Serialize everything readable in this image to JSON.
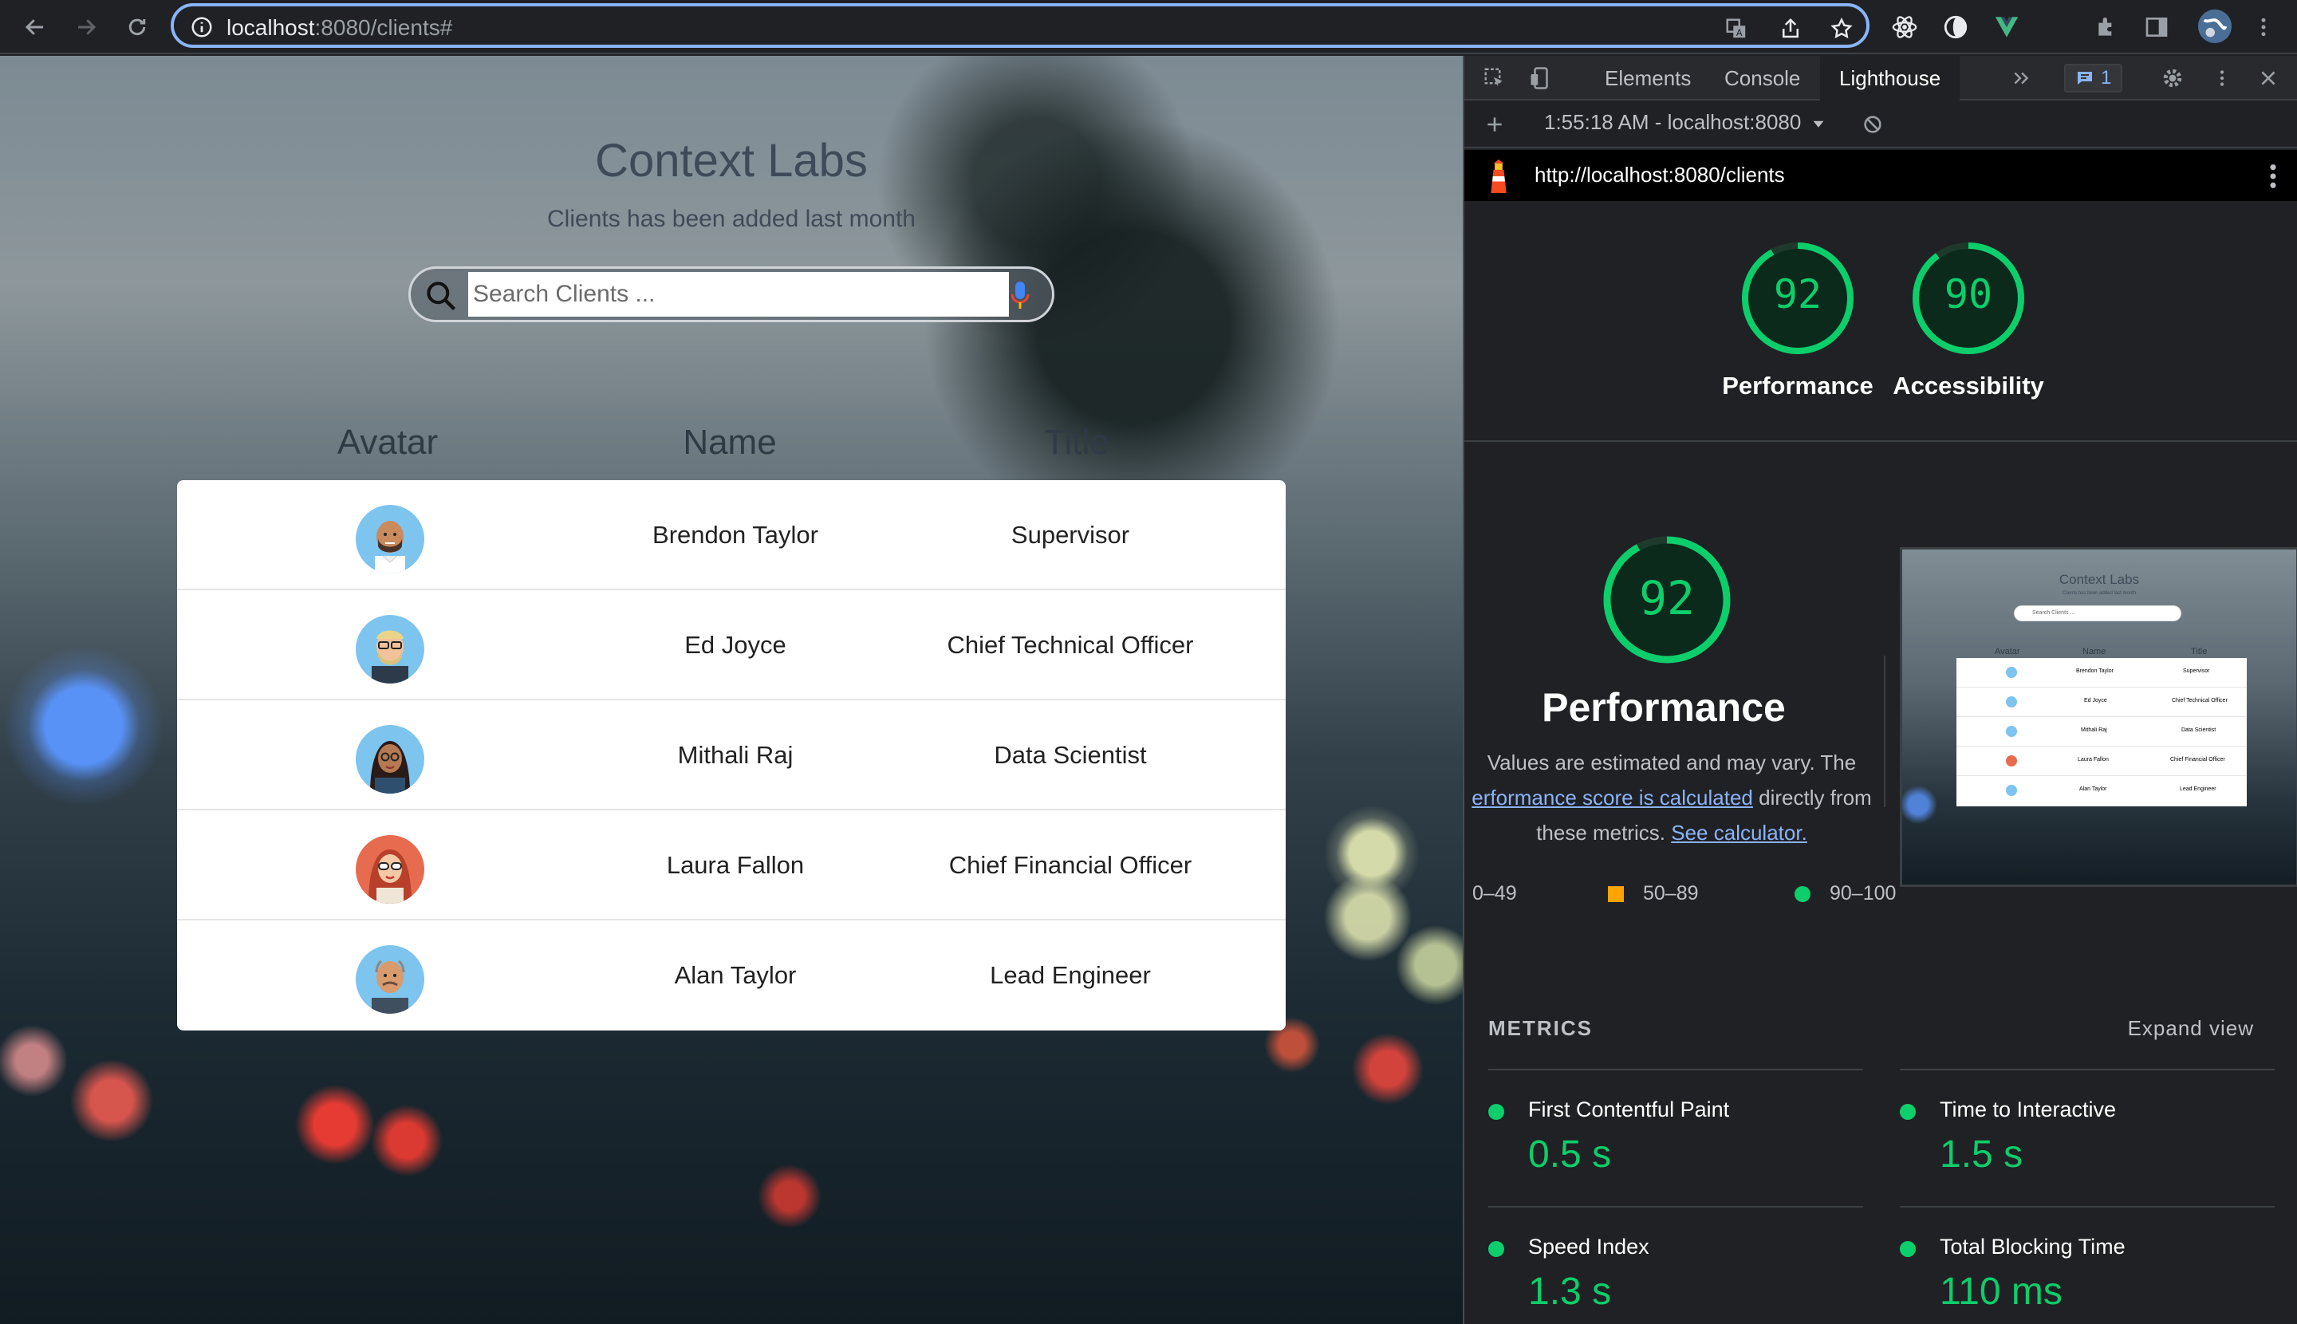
{
  "browser": {
    "url_host": "localhost",
    "url_rest": ":8080/clients#"
  },
  "app": {
    "title": "Context Labs",
    "subtitle": "Clients has been added last month",
    "search_placeholder": "Search Clients ...",
    "columns": [
      "Avatar",
      "Name",
      "Title"
    ],
    "clients": [
      {
        "name": "Brendon Taylor",
        "title": "Supervisor"
      },
      {
        "name": "Ed Joyce",
        "title": "Chief Technical Officer"
      },
      {
        "name": "Mithali Raj",
        "title": "Data Scientist"
      },
      {
        "name": "Laura Fallon",
        "title": "Chief Financial Officer"
      },
      {
        "name": "Alan Taylor",
        "title": "Lead Engineer"
      }
    ]
  },
  "devtools": {
    "tabs": [
      "Elements",
      "Console",
      "Lighthouse"
    ],
    "active_tab": "Lighthouse",
    "issues_count": "1",
    "report_select": "1:55:18 AM - localhost:8080",
    "report_url": "http://localhost:8080/clients",
    "scores": [
      {
        "label": "Performance",
        "value": "92",
        "fraction": 0.92
      },
      {
        "label": "Accessibility",
        "value": "90",
        "fraction": 0.9
      }
    ],
    "perf_big": {
      "value": "92",
      "fraction": 0.92,
      "title": "Performance"
    },
    "perf_desc_1": "Values are estimated and may vary. The",
    "perf_desc_link": "erformance score is calculated",
    "perf_desc_2": "directly from",
    "perf_desc_3": "these metrics.",
    "perf_desc_link2": "See calculator.",
    "legend": [
      "0–49",
      "50–89",
      "90–100"
    ],
    "thumbnail": {
      "title": "Context Labs",
      "subtitle": "Clients has been added last month",
      "search": "Search Clients ..."
    },
    "metrics_header": "METRICS",
    "expand_view": "Expand view",
    "metrics": [
      {
        "label": "First Contentful Paint",
        "value": "0.5 s"
      },
      {
        "label": "Time to Interactive",
        "value": "1.5 s"
      },
      {
        "label": "Speed Index",
        "value": "1.3 s"
      },
      {
        "label": "Total Blocking Time",
        "value": "110 ms"
      }
    ],
    "colors": {
      "pass": "#0cce6b",
      "average": "#ffa400",
      "fail": "#ff4e42"
    }
  }
}
